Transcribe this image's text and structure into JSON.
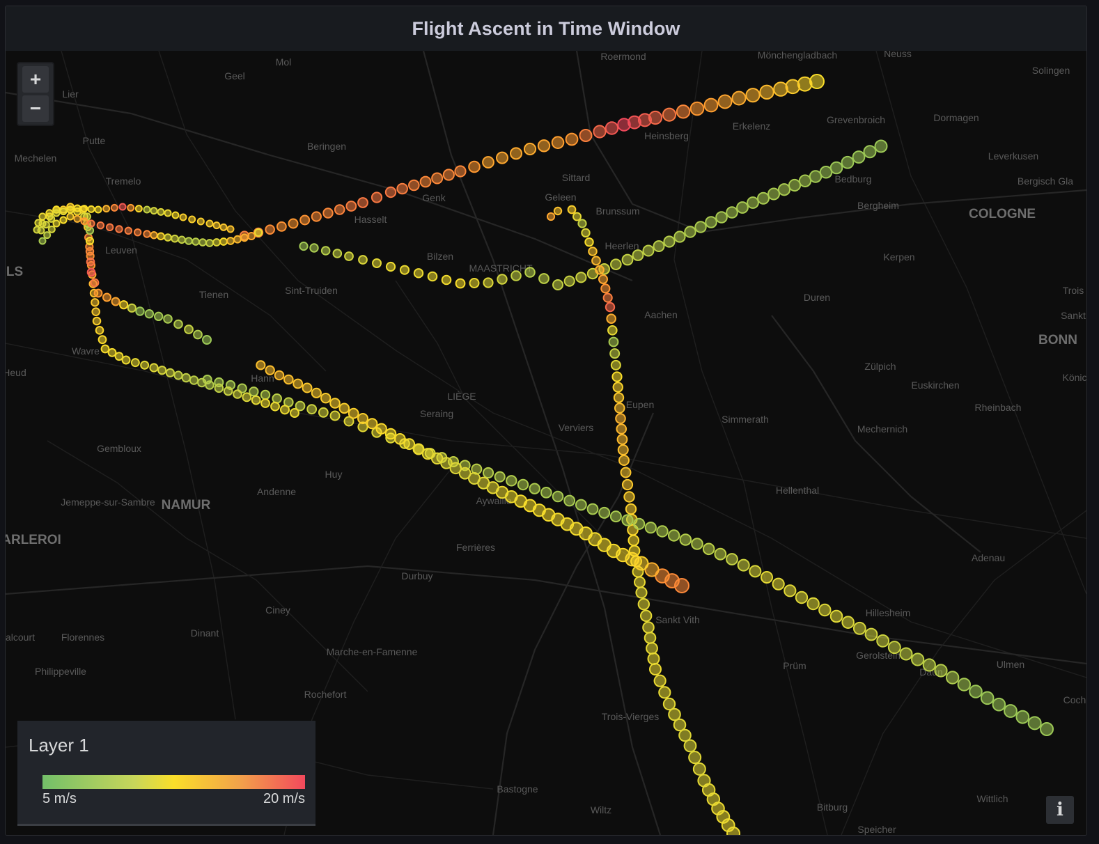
{
  "panel": {
    "title": "Flight Ascent in Time Window"
  },
  "zoom": {
    "in_label": "+",
    "out_label": "−"
  },
  "legend": {
    "title": "Layer 1",
    "min_label": "5 m/s",
    "max_label": "20 m/s"
  },
  "info": {
    "label": "i"
  },
  "colors": {
    "low": "#73bf69",
    "mid": "#fade2a",
    "high": "#f2495c",
    "orange": "#ff9830"
  },
  "places": [
    {
      "name": "Roermond",
      "kind": "town"
    },
    {
      "name": "Mönchengladbach",
      "kind": "town"
    },
    {
      "name": "Neuss",
      "kind": "town"
    },
    {
      "name": "Solingen",
      "kind": "town"
    },
    {
      "name": "Mol",
      "kind": "town"
    },
    {
      "name": "Geel",
      "kind": "town"
    },
    {
      "name": "Lier",
      "kind": "town"
    },
    {
      "name": "Putte",
      "kind": "town"
    },
    {
      "name": "Mechelen",
      "kind": "town"
    },
    {
      "name": "Tremelo",
      "kind": "town"
    },
    {
      "name": "Beringen",
      "kind": "town"
    },
    {
      "name": "Heinsberg",
      "kind": "town"
    },
    {
      "name": "Erkelenz",
      "kind": "town"
    },
    {
      "name": "Grevenbroich",
      "kind": "town"
    },
    {
      "name": "Dormagen",
      "kind": "town"
    },
    {
      "name": "Leverkusen",
      "kind": "town"
    },
    {
      "name": "Bergisch Gla",
      "kind": "town"
    },
    {
      "name": "Genk",
      "kind": "town"
    },
    {
      "name": "Hasselt",
      "kind": "town"
    },
    {
      "name": "Sittard",
      "kind": "town"
    },
    {
      "name": "Geleen",
      "kind": "town"
    },
    {
      "name": "Brunssum",
      "kind": "town"
    },
    {
      "name": "Bedburg",
      "kind": "town"
    },
    {
      "name": "Bergheim",
      "kind": "town"
    },
    {
      "name": "COLOGNE",
      "kind": "city"
    },
    {
      "name": "LS",
      "kind": "city"
    },
    {
      "name": "Leuven",
      "kind": "town"
    },
    {
      "name": "Bilzen",
      "kind": "town"
    },
    {
      "name": "MAASTRICHT",
      "kind": "town"
    },
    {
      "name": "Heerlen",
      "kind": "town"
    },
    {
      "name": "Kerpen",
      "kind": "town"
    },
    {
      "name": "Tienen",
      "kind": "town"
    },
    {
      "name": "Sint-Truiden",
      "kind": "town"
    },
    {
      "name": "Aachen",
      "kind": "town"
    },
    {
      "name": "Duren",
      "kind": "town"
    },
    {
      "name": "Trois",
      "kind": "town"
    },
    {
      "name": "Sankt",
      "kind": "town"
    },
    {
      "name": "BONN",
      "kind": "city"
    },
    {
      "name": "Wavre",
      "kind": "town"
    },
    {
      "name": "Zülpich",
      "kind": "town"
    },
    {
      "name": "Könic",
      "kind": "town"
    },
    {
      "name": "Heud",
      "kind": "town"
    },
    {
      "name": "Hann",
      "kind": "town"
    },
    {
      "name": "Euskirchen",
      "kind": "town"
    },
    {
      "name": "LIÈGE",
      "kind": "town"
    },
    {
      "name": "Seraing",
      "kind": "town"
    },
    {
      "name": "Eupen",
      "kind": "town"
    },
    {
      "name": "Rheinbach",
      "kind": "town"
    },
    {
      "name": "Verviers",
      "kind": "town"
    },
    {
      "name": "Simmerath",
      "kind": "town"
    },
    {
      "name": "Mechernich",
      "kind": "town"
    },
    {
      "name": "Gembloux",
      "kind": "town"
    },
    {
      "name": "Huy",
      "kind": "town"
    },
    {
      "name": "Andenne",
      "kind": "town"
    },
    {
      "name": "Hellenthal",
      "kind": "town"
    },
    {
      "name": "Jemeppe-sur-Sambre",
      "kind": "town"
    },
    {
      "name": "NAMUR",
      "kind": "city"
    },
    {
      "name": "Aywaille",
      "kind": "town"
    },
    {
      "name": "ARLEROI",
      "kind": "city"
    },
    {
      "name": "Ferrières",
      "kind": "town"
    },
    {
      "name": "Adenau",
      "kind": "town"
    },
    {
      "name": "Durbuy",
      "kind": "town"
    },
    {
      "name": "Ciney",
      "kind": "town"
    },
    {
      "name": "Sankt Vith",
      "kind": "town"
    },
    {
      "name": "Hillesheim",
      "kind": "town"
    },
    {
      "name": "alcourt",
      "kind": "town"
    },
    {
      "name": "Florennes",
      "kind": "town"
    },
    {
      "name": "Dinant",
      "kind": "town"
    },
    {
      "name": "Marche-en-Famenne",
      "kind": "town"
    },
    {
      "name": "Gerolstein",
      "kind": "town"
    },
    {
      "name": "Prüm",
      "kind": "town"
    },
    {
      "name": "Ulmen",
      "kind": "town"
    },
    {
      "name": "Philippeville",
      "kind": "town"
    },
    {
      "name": "Rochefort",
      "kind": "town"
    },
    {
      "name": "Daun",
      "kind": "town"
    },
    {
      "name": "Coch",
      "kind": "town"
    },
    {
      "name": "Trois-Vierges",
      "kind": "town"
    },
    {
      "name": "Bastogne",
      "kind": "town"
    },
    {
      "name": "Wittlich",
      "kind": "town"
    },
    {
      "name": "Bitburg",
      "kind": "town"
    },
    {
      "name": "Wiltz",
      "kind": "town"
    },
    {
      "name": "Speicher",
      "kind": "town"
    }
  ]
}
